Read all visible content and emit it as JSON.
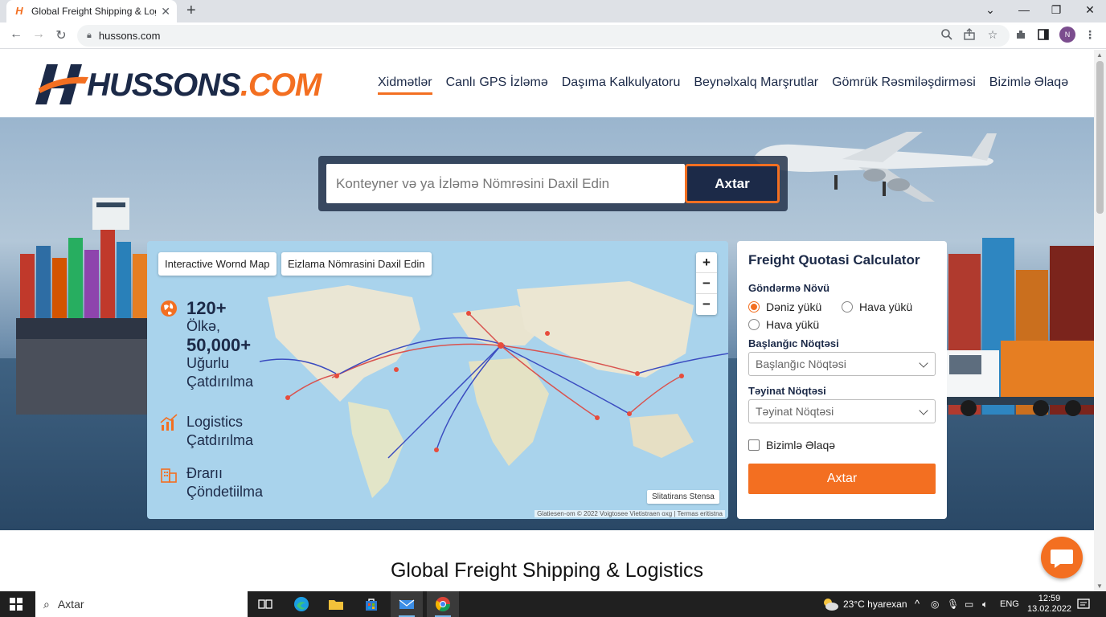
{
  "browser": {
    "tab_title": "Global Freight Shipping & Logis",
    "url": "hussons.com",
    "profile_initial": "N"
  },
  "site": {
    "logo_main": "HUSSONS",
    "logo_tld": ".COM",
    "nav": [
      "Xidmətlər",
      "Canlı GPS İzləmə",
      "Daşıma Kalkulyatoru",
      "Beynəlxalq Marşrutlar",
      "Gömrük Rəsmiləşdirməsi",
      "Bizimlə Əlaqə"
    ],
    "active_nav": 0
  },
  "search": {
    "placeholder": "Konteyner və ya İzləmə Nömrəsini Daxil Edin",
    "button": "Axtar"
  },
  "map": {
    "chip_1": "Interactive Wornd Map",
    "chip_2": "Eizlama Nömrasini Daxil Edin",
    "zoom_in": "+",
    "zoom_out_1": "−",
    "zoom_out_2": "−",
    "stat_1_big": "120+",
    "stat_1_small": "Ölkə,",
    "stat_1_big2": "50,000+",
    "stat_1_small2": "Uğurlu",
    "stat_1_small3": "Çatdırılma",
    "stat_2_line1": "Logistics",
    "stat_2_line2": "Çatdırılma",
    "stat_3_line1": "Ðrarıı",
    "stat_3_line2": "Çöndetiilma",
    "sat_button": "Slitatirans Stensa",
    "attribution": "Glatiesen-om © 2022 Voigtosee Vietistraen oxg | Termas eritistna"
  },
  "quote": {
    "title": "Freight Quotasi Calculator",
    "type_label": "Göndərmə Növü",
    "radio_1": "Dəniz yükü",
    "radio_2": "Hava yükü",
    "radio_3": "Hava yükü",
    "origin_label": "Başlanğıc Nöqtəsi",
    "origin_value": "Başlanğıc Nöqtəsi",
    "dest_label": "Təyinat Nöqtəsi",
    "dest_value": "Təyinat Nöqtəsi",
    "checkbox": "Bizimlə Əlaqə",
    "button": "Axtar"
  },
  "section_title": "Global Freight Shipping & Logistics",
  "taskbar": {
    "search_placeholder": "Axtar",
    "weather": "23°C  hyarexan",
    "lang": "ENG",
    "time": "12:59",
    "date": "13.02.2022"
  },
  "colors": {
    "accent": "#f36f21",
    "navy": "#1c2a48"
  }
}
